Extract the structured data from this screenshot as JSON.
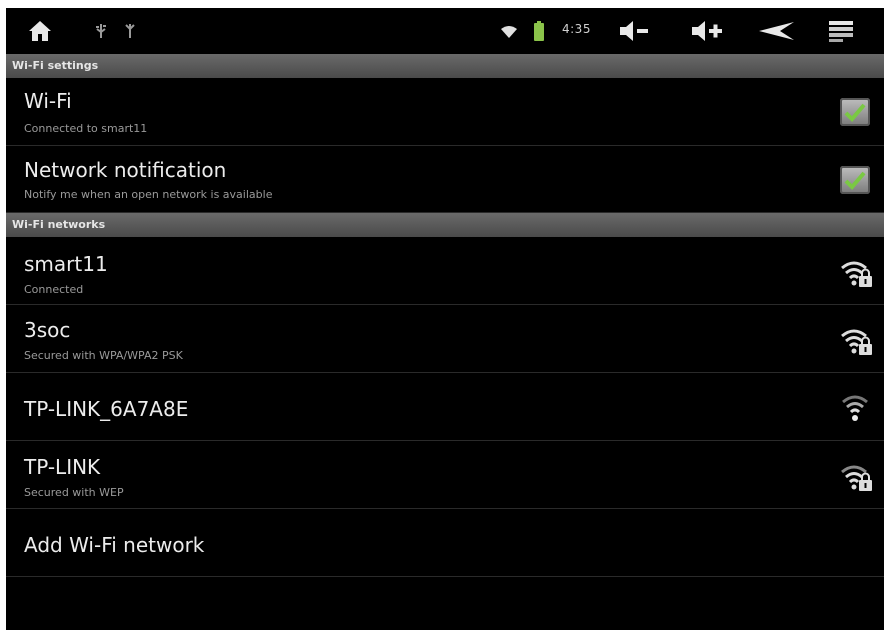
{
  "status_bar": {
    "time": "4:35",
    "icons": [
      "home-icon",
      "usb-icon",
      "debug-icon",
      "wifi-signal-icon",
      "battery-icon",
      "volume-down-icon",
      "volume-up-icon",
      "back-icon",
      "menu-icon"
    ]
  },
  "sections": {
    "wifi_settings": "Wi-Fi settings",
    "wifi_networks": "Wi-Fi networks"
  },
  "settings": [
    {
      "title": "Wi-Fi",
      "subtitle": "Connected to smart11",
      "checked": true
    },
    {
      "title": "Network notification",
      "subtitle": "Notify me when an open network is available",
      "checked": true
    }
  ],
  "networks": [
    {
      "ssid": "smart11",
      "status": "Connected",
      "secured": true
    },
    {
      "ssid": "3soc",
      "status": "Secured with WPA/WPA2 PSK",
      "secured": true
    },
    {
      "ssid": "TP-LINK_6A7A8E",
      "status": "",
      "secured": false
    },
    {
      "ssid": "TP-LINK",
      "status": "Secured with WEP",
      "secured": true
    }
  ],
  "add_network": "Add Wi-Fi network",
  "colors": {
    "accent_check": "#7ac943",
    "battery": "#8bc34a"
  }
}
